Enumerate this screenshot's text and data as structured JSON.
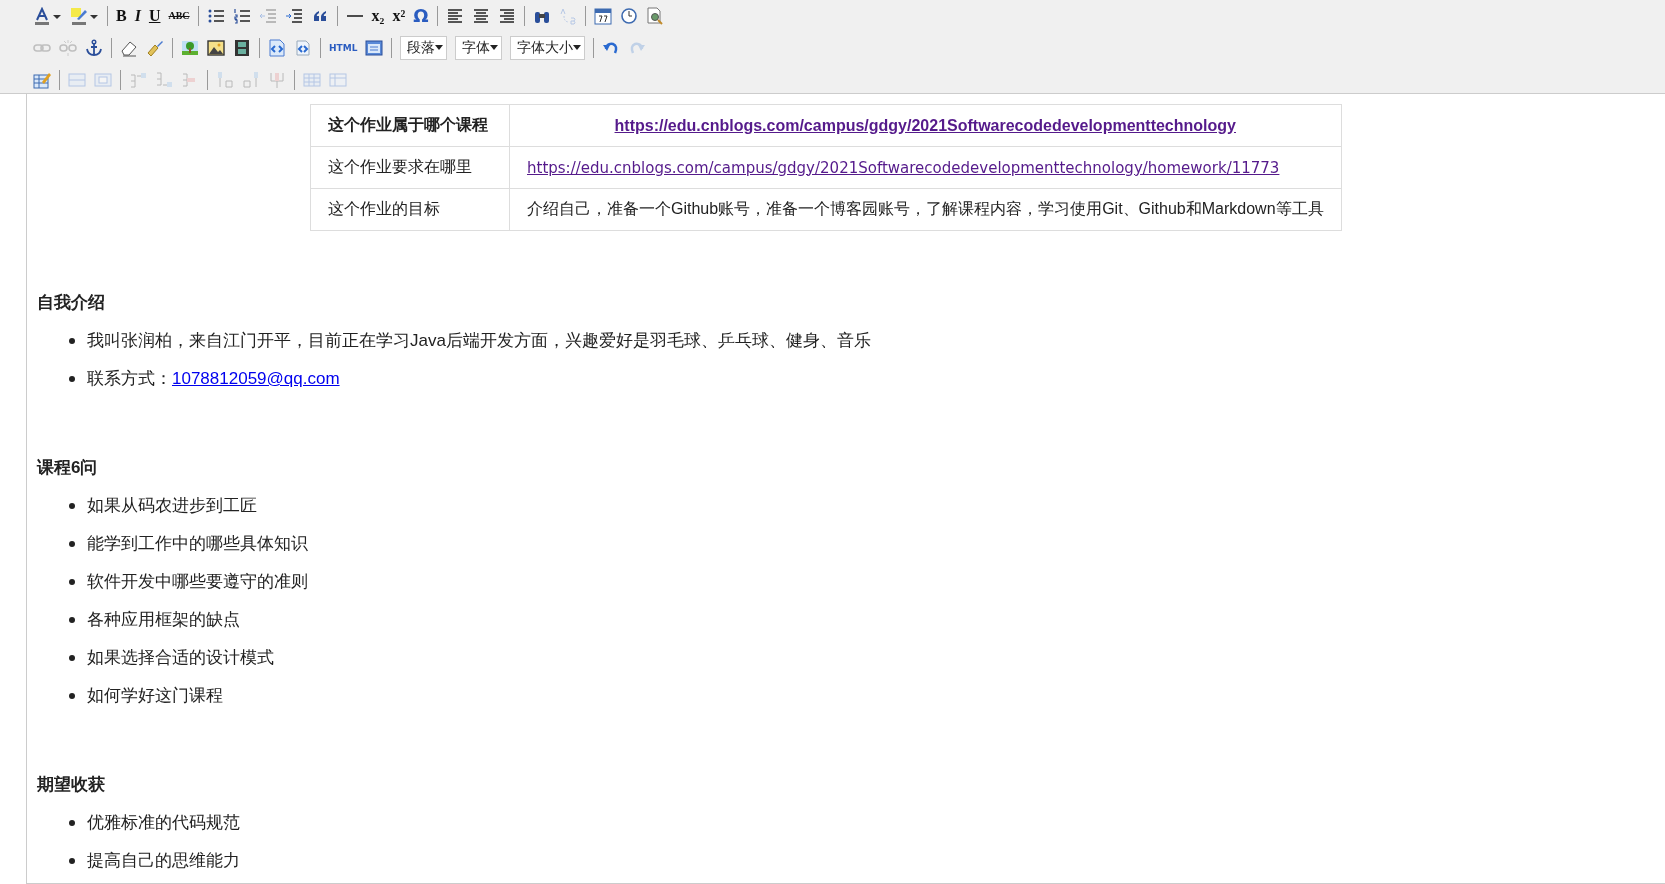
{
  "toolbar": {
    "rows": [
      {
        "items": [
          {
            "kind": "font-color",
            "disabled": false
          },
          {
            "kind": "caret",
            "disabled": false
          },
          {
            "kind": "highlight",
            "disabled": false
          },
          {
            "kind": "caret",
            "disabled": false
          },
          {
            "kind": "sep"
          },
          {
            "kind": "bold",
            "text": "B",
            "disabled": false
          },
          {
            "kind": "italic",
            "text": "I",
            "disabled": false
          },
          {
            "kind": "underline",
            "text": "U",
            "disabled": false
          },
          {
            "kind": "strike",
            "text": "ABC",
            "disabled": false
          },
          {
            "kind": "sep"
          },
          {
            "kind": "bullet-list",
            "disabled": false
          },
          {
            "kind": "numbered-list",
            "disabled": false
          },
          {
            "kind": "outdent",
            "disabled": true
          },
          {
            "kind": "indent",
            "disabled": false
          },
          {
            "kind": "quote",
            "disabled": false
          },
          {
            "kind": "sep"
          },
          {
            "kind": "rule",
            "disabled": false
          },
          {
            "kind": "subscript",
            "text": "x₂",
            "disabled": false
          },
          {
            "kind": "superscript",
            "text": "x²",
            "disabled": false
          },
          {
            "kind": "omega",
            "text": "Ω",
            "disabled": false
          },
          {
            "kind": "sep"
          },
          {
            "kind": "align-left",
            "disabled": false
          },
          {
            "kind": "align-center",
            "disabled": false
          },
          {
            "kind": "align-right",
            "disabled": false
          },
          {
            "kind": "sep"
          },
          {
            "kind": "find",
            "disabled": false
          },
          {
            "kind": "replace",
            "disabled": true
          },
          {
            "kind": "sep"
          },
          {
            "kind": "calendar",
            "disabled": false
          },
          {
            "kind": "clock",
            "disabled": false
          },
          {
            "kind": "preview",
            "disabled": false
          }
        ]
      },
      {
        "items": [
          {
            "kind": "link",
            "disabled": true
          },
          {
            "kind": "unlink",
            "disabled": true
          },
          {
            "kind": "anchor",
            "disabled": false
          },
          {
            "kind": "sep"
          },
          {
            "kind": "eraser",
            "disabled": false
          },
          {
            "kind": "brush",
            "disabled": false
          },
          {
            "kind": "sep"
          },
          {
            "kind": "picture",
            "disabled": false
          },
          {
            "kind": "image",
            "disabled": false
          },
          {
            "kind": "film",
            "disabled": false
          },
          {
            "kind": "sep"
          },
          {
            "kind": "code",
            "disabled": false
          },
          {
            "kind": "code-small",
            "disabled": false
          },
          {
            "kind": "sep"
          },
          {
            "kind": "html",
            "text": "HTML",
            "disabled": false
          },
          {
            "kind": "window",
            "disabled": false
          },
          {
            "kind": "sep"
          },
          {
            "kind": "select",
            "value": "段落"
          },
          {
            "kind": "select",
            "value": "字体"
          },
          {
            "kind": "select",
            "value": "字体大小"
          },
          {
            "kind": "sep"
          },
          {
            "kind": "undo",
            "disabled": false
          },
          {
            "kind": "redo",
            "disabled": true
          }
        ]
      },
      {
        "items": [
          {
            "kind": "table-edit",
            "disabled": false
          },
          {
            "kind": "sep"
          },
          {
            "kind": "table-row",
            "disabled": true
          },
          {
            "kind": "table-cell",
            "disabled": true
          },
          {
            "kind": "sep"
          },
          {
            "kind": "row-before",
            "disabled": true
          },
          {
            "kind": "row-after",
            "disabled": true
          },
          {
            "kind": "row-delete",
            "disabled": true
          },
          {
            "kind": "sep"
          },
          {
            "kind": "col-before",
            "disabled": true
          },
          {
            "kind": "col-after",
            "disabled": true
          },
          {
            "kind": "col-delete",
            "disabled": true
          },
          {
            "kind": "sep"
          },
          {
            "kind": "table-grid",
            "disabled": true
          },
          {
            "kind": "table-split",
            "disabled": true
          }
        ]
      }
    ]
  },
  "table": {
    "rows": [
      {
        "label": "这个作业属于哪个课程",
        "value": "https://edu.cnblogs.com/campus/gdgy/2021Softwarecodedevelopmenttechnology",
        "kind": "link",
        "bold": true
      },
      {
        "label": "这个作业要求在哪里",
        "value": "https://edu.cnblogs.com/campus/gdgy/2021Softwarecodedevelopmenttechnology/homework/11773",
        "kind": "link",
        "bold": false
      },
      {
        "label": "这个作业的目标",
        "value": "介绍自己，准备一个Github账号，准备一个博客园账号，了解课程内容，学习使用Git、Github和Markdown等工具",
        "kind": "text",
        "bold": false
      }
    ]
  },
  "sections": [
    {
      "heading": "自我介绍",
      "items": [
        {
          "text": "我叫张润柏，来自江门开平，目前正在学习Java后端开发方面，兴趣爱好是羽毛球、乒乓球、健身、音乐"
        },
        {
          "text": "联系方式：",
          "link": "1078812059@qq.com"
        }
      ]
    },
    {
      "heading": "课程6问",
      "items": [
        {
          "text": "如果从码农进步到工匠"
        },
        {
          "text": "能学到工作中的哪些具体知识"
        },
        {
          "text": "软件开发中哪些要遵守的准则"
        },
        {
          "text": "各种应用框架的缺点"
        },
        {
          "text": "如果选择合适的设计模式"
        },
        {
          "text": "如何学好这门课程"
        }
      ]
    },
    {
      "heading": "期望收获",
      "items": [
        {
          "text": "优雅标准的代码规范"
        },
        {
          "text": "提高自己的思维能力"
        }
      ]
    }
  ]
}
